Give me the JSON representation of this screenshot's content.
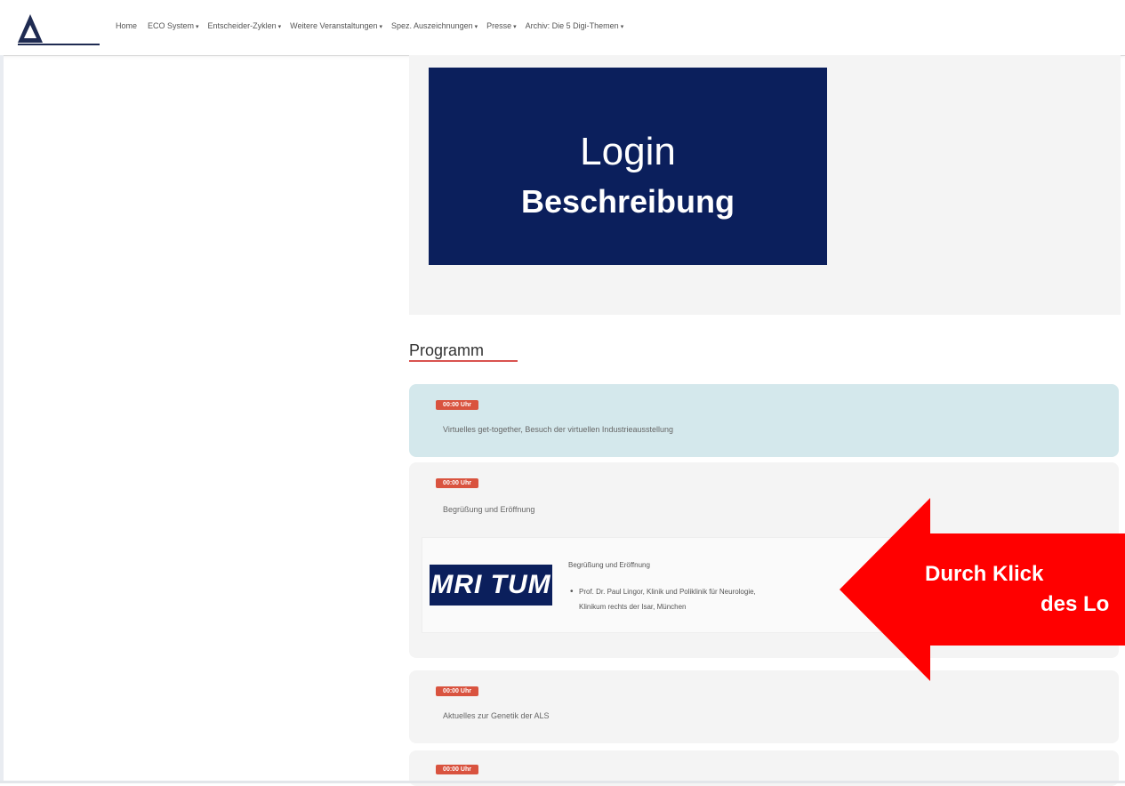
{
  "nav": {
    "items": [
      {
        "label": "Home",
        "caret": ""
      },
      {
        "label": "ECO System",
        "caret": "▾"
      },
      {
        "label": "Entscheider-Zyklen",
        "caret": "▾"
      },
      {
        "label": "Weitere Veranstaltungen",
        "caret": "▾"
      },
      {
        "label": "Spez. Auszeichnungen",
        "caret": "▾"
      },
      {
        "label": "Presse",
        "caret": "▾"
      },
      {
        "label": "Archiv: Die 5 Digi-Themen",
        "caret": "▾"
      }
    ]
  },
  "hero": {
    "line1": "Login",
    "line2": "Beschreibung",
    "color": "#0b1f5c"
  },
  "program": {
    "title": "Programm",
    "items": [
      {
        "badge": "00:00 Uhr",
        "text": "Virtuelles get-together, Besuch der virtuellen Industrieausstellung"
      },
      {
        "badge": "00:00 Uhr",
        "text": "Begrüßung und Eröffnung"
      },
      {
        "badge": "00:00 Uhr",
        "text": "Aktuelles zur Genetik der ALS"
      },
      {
        "badge": "00:00 Uhr",
        "text": ""
      }
    ],
    "detail": {
      "logo_text": "MRI TUM",
      "title": "Begrüßung und Eröffnung",
      "bullet_line1": "Prof. Dr. Paul Lingor, Klinik und Poliklinik für Neurologie,",
      "bullet_line2": "Klinikum rechts der Isar, München"
    }
  },
  "annotation": {
    "line1": "Durch Klick",
    "line2": "des Lo",
    "color": "#ff0000"
  }
}
